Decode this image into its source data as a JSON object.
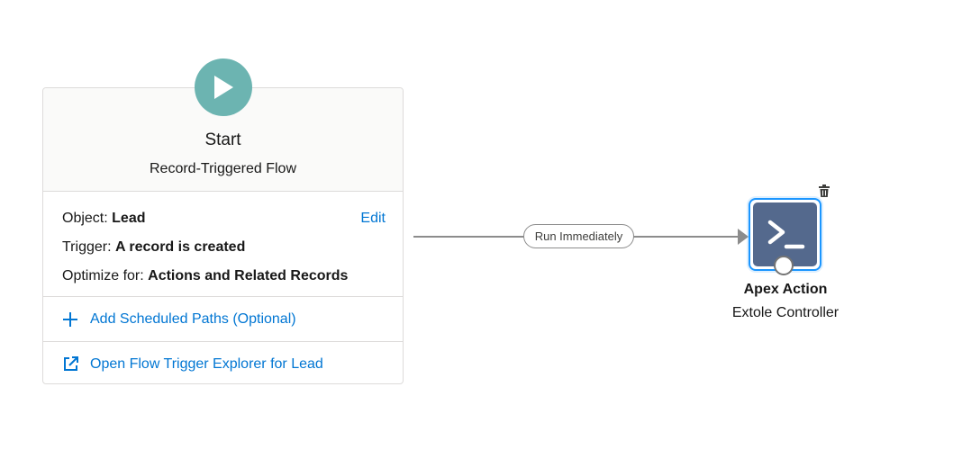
{
  "start": {
    "title": "Start",
    "subtitle": "Record-Triggered Flow",
    "icon": "play-icon",
    "icon_color": "#6cb4b1",
    "object_label": "Object:",
    "object_value": "Lead",
    "edit_label": "Edit",
    "trigger_label": "Trigger:",
    "trigger_value": "A record is created",
    "optimize_label": "Optimize for:",
    "optimize_value": "Actions and Related Records",
    "add_scheduled_label": "Add Scheduled Paths (Optional)",
    "open_explorer_label": "Open Flow Trigger Explorer for Lead"
  },
  "connector": {
    "label": "Run Immediately"
  },
  "apex_action": {
    "title": "Apex Action",
    "subtitle": "Extole Controller",
    "icon": "apex-terminal-icon",
    "icon_color": "#54698d"
  },
  "colors": {
    "link": "#0176d3",
    "selection": "#1b96ff"
  }
}
